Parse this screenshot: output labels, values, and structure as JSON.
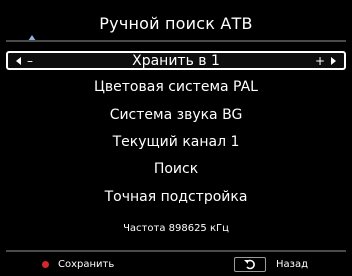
{
  "title": "Ручной поиск АТВ",
  "selected": {
    "left_symbol": "–",
    "label": "Хранить в 1",
    "right_symbol": "+"
  },
  "items": [
    "Цветовая система PAL",
    "Система звука BG",
    "Текущий канал 1",
    "Поиск",
    "Точная подстройка"
  ],
  "frequency": "Частота 898625 кГц",
  "footer": {
    "save_label": "Сохранить",
    "back_label": "Назад"
  },
  "colors": {
    "background": "#000000",
    "text": "#ffffff",
    "save_dot": "#d8262d",
    "scroll_arrow": "#8fb3e0",
    "divider": "#4a4a4a"
  }
}
